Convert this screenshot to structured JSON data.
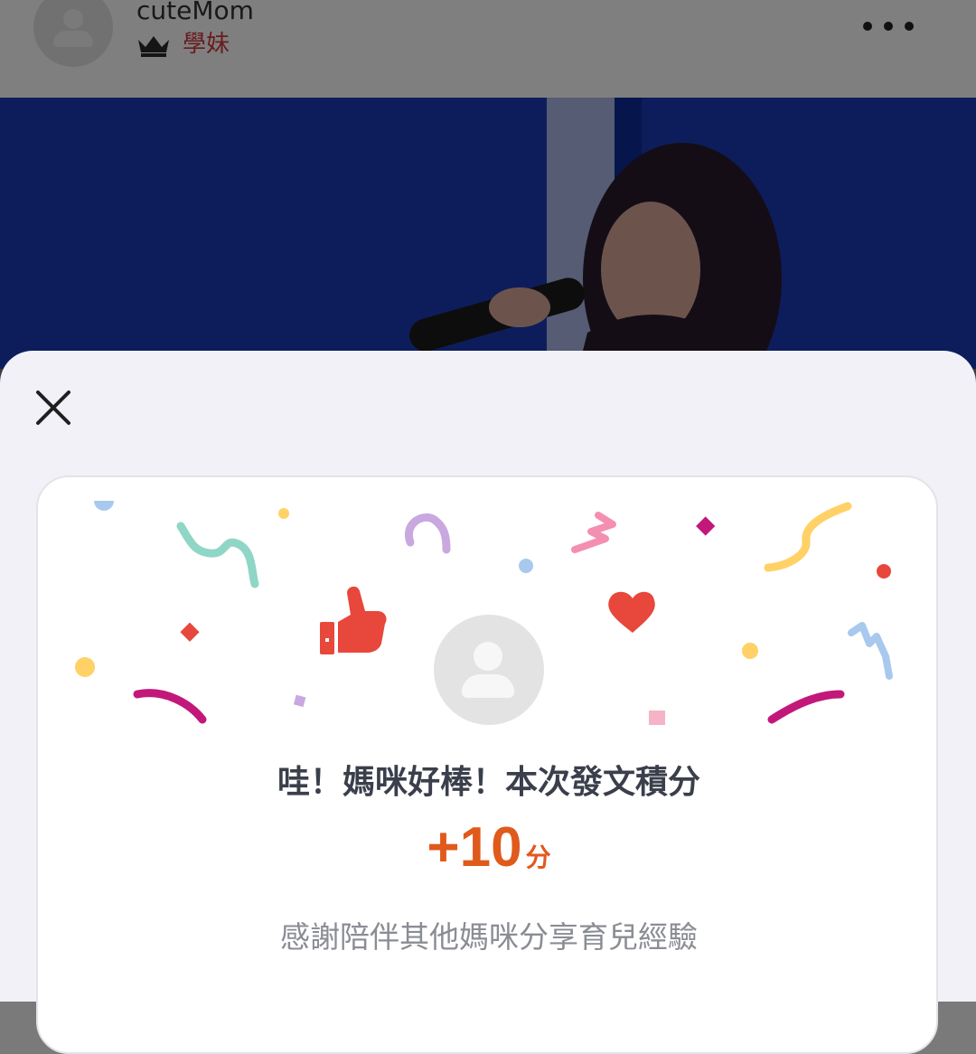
{
  "post": {
    "author_name": "cuteMom",
    "author_rank": "學妹",
    "rank_icon": "crown-icon",
    "more_icon": "more-horizontal-icon",
    "photo_subject": "singer-with-microphone-photo"
  },
  "reward_sheet": {
    "close_icon": "close-icon",
    "headline": "哇！媽咪好棒！本次發文積分",
    "points_value": "+10",
    "points_unit": "分",
    "message": "感謝陪伴其他媽咪分享育兒經驗",
    "accent_color": "#e05a1c"
  }
}
